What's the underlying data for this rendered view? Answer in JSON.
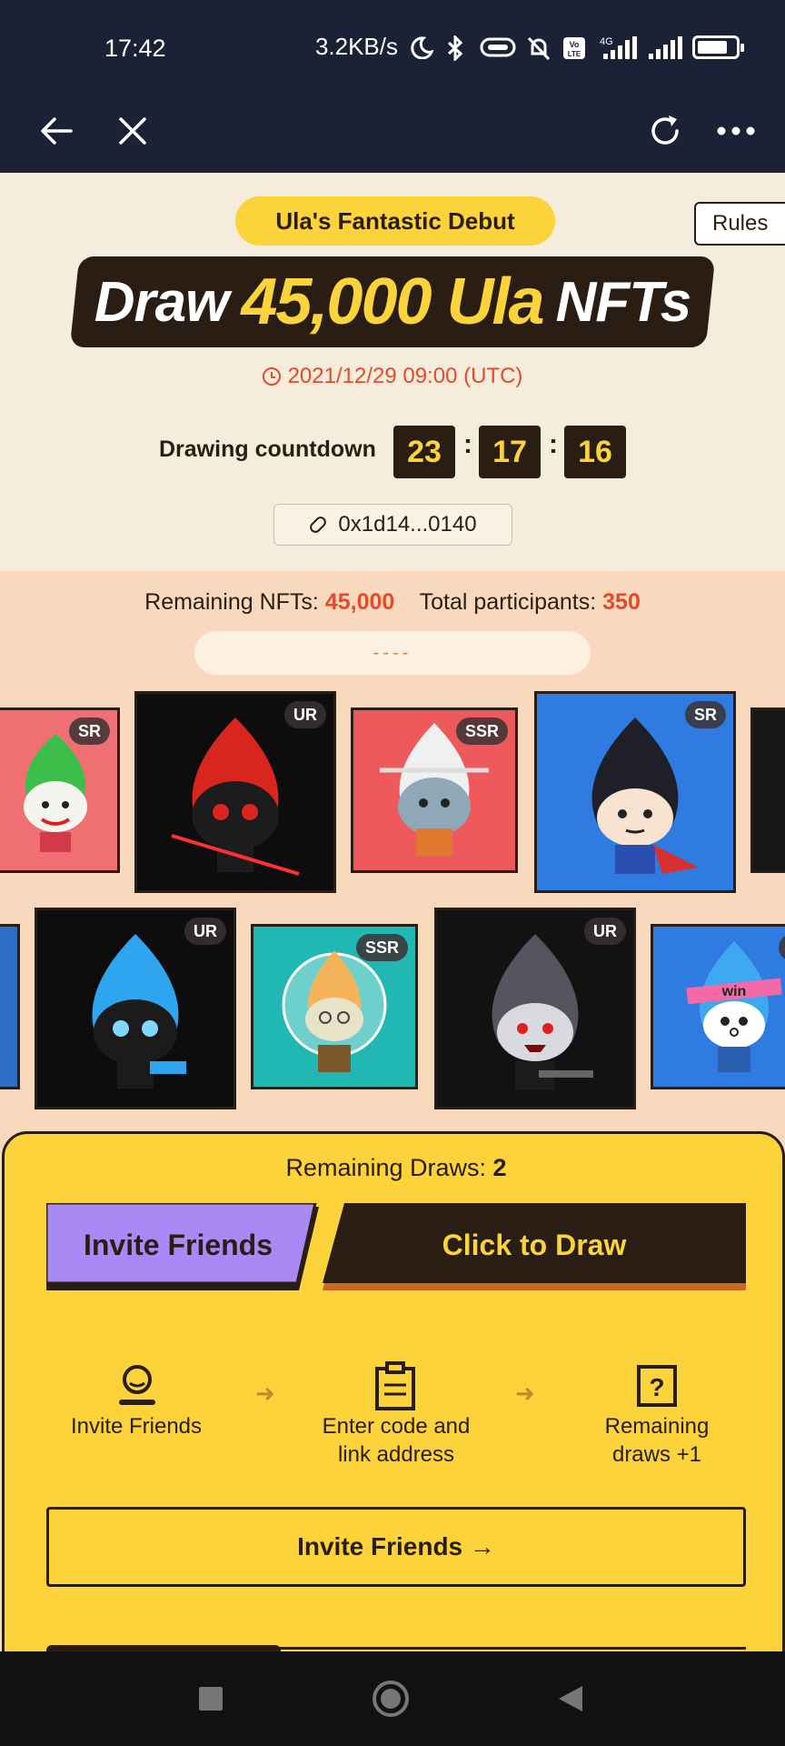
{
  "status_bar": {
    "time": "17:42",
    "network_speed": "3.2KB/s",
    "icons": [
      "moon-icon",
      "bluetooth-icon",
      "data-saver-icon",
      "mute-icon",
      "volte-icon",
      "signal-4g-icon",
      "signal-icon",
      "battery-icon"
    ],
    "signal_label": "4G",
    "volte_label": "Vo LTE",
    "battery_level": 0.8
  },
  "app_bar": {
    "icons": [
      "back-arrow-icon",
      "close-icon",
      "refresh-icon",
      "more-icon"
    ]
  },
  "header": {
    "pill_text": "Ula's Fantastic Debut",
    "rules_label": "Rules",
    "headline_prefix": "Draw",
    "headline_number": "45,000 Ula",
    "headline_suffix": "NFTs",
    "date": "2021/12/29 09:00 (UTC)",
    "countdown_label": "Drawing countdown",
    "countdown": {
      "hours": "23",
      "minutes": "17",
      "seconds": "16"
    },
    "separator": ":",
    "address": "0x1d14...0140"
  },
  "stats": {
    "remaining_label": "Remaining NFTs:",
    "remaining_value": "45,000",
    "participants_label": "Total participants:",
    "participants_value": "350",
    "ticker_text": "----"
  },
  "nft_cards": {
    "row1": [
      {
        "rarity": "SR",
        "bg": "#ef6f73",
        "char": "joker"
      },
      {
        "rarity": "UR",
        "bg": "#0d0d0d",
        "char": "red-flame"
      },
      {
        "rarity": "SSR",
        "bg": "#ee5a5c",
        "char": "white-flame"
      },
      {
        "rarity": "SR",
        "bg": "#2f7be2",
        "char": "black-flame"
      },
      {
        "rarity": "",
        "bg": "#161616",
        "char": "edge"
      }
    ],
    "row2": [
      {
        "rarity": "",
        "bg": "#2b6ec4",
        "char": "edge"
      },
      {
        "rarity": "UR",
        "bg": "#0d0d0d",
        "char": "blue-flame"
      },
      {
        "rarity": "SSR",
        "bg": "#21b7b2",
        "char": "astronaut"
      },
      {
        "rarity": "UR",
        "bg": "#121212",
        "char": "vampire"
      },
      {
        "rarity": "S",
        "bg": "#2f7be2",
        "char": "win",
        "headband": "win"
      }
    ]
  },
  "draw_panel": {
    "remaining_label": "Remaining Draws:",
    "remaining_value": "2",
    "invite_tab_label": "Invite Friends",
    "draw_tab_label": "Click to Draw",
    "steps": [
      {
        "label": "Invite Friends",
        "icon": "person-icon"
      },
      {
        "label_line1": "Enter code and",
        "label_line2": "link address",
        "icon": "clipboard-icon"
      },
      {
        "label_line1": "Remaining",
        "label_line2": "draws +1",
        "icon": "question-box-icon"
      }
    ],
    "invite_button_label": "Invite Friends",
    "invite_button_arrow": "→",
    "step_arrow": "➜"
  },
  "colors": {
    "dark": "#2a1d14",
    "accent_yellow": "#fbd33a",
    "accent_red": "#e24b2b",
    "purple_tab": "#a98af5",
    "header_bg": "#f6ecdc",
    "gallery_bg": "#f9d9bd",
    "status_bg": "#1b2236"
  }
}
